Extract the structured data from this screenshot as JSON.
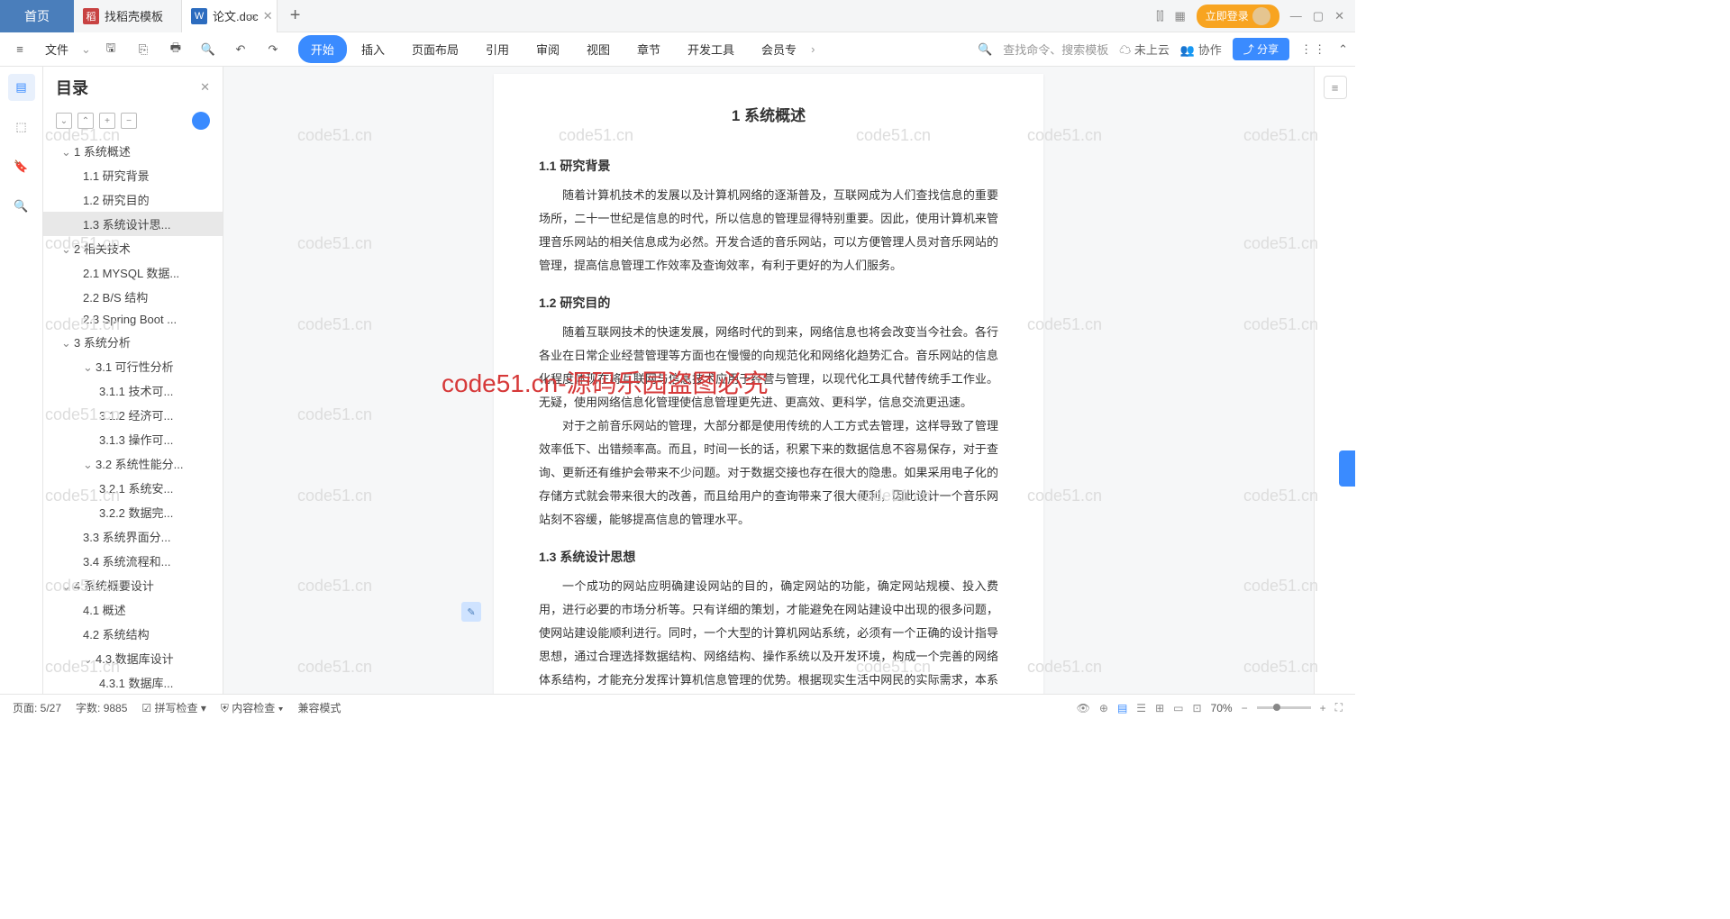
{
  "tabs": {
    "home": "首页",
    "t1": "找稻壳模板",
    "t2": "论文.doc",
    "login": "立即登录"
  },
  "menu": {
    "file": "文件",
    "items": [
      "开始",
      "插入",
      "页面布局",
      "引用",
      "审阅",
      "视图",
      "章节",
      "开发工具",
      "会员专"
    ],
    "search": "查找命令、搜索模板",
    "cloud": "未上云",
    "collab": "协作",
    "share": "分享"
  },
  "sidebar": {
    "title": "目录"
  },
  "toc": [
    {
      "l": 1,
      "c": true,
      "t": "1 系统概述"
    },
    {
      "l": 2,
      "t": "1.1 研究背景"
    },
    {
      "l": 2,
      "t": "1.2 研究目的"
    },
    {
      "l": 2,
      "t": "1.3 系统设计思...",
      "sel": true
    },
    {
      "l": 1,
      "c": true,
      "t": "2 相关技术"
    },
    {
      "l": 2,
      "t": "2.1 MYSQL 数据..."
    },
    {
      "l": 2,
      "t": "2.2 B/S 结构"
    },
    {
      "l": 2,
      "t": "2.3 Spring Boot ..."
    },
    {
      "l": 1,
      "c": true,
      "t": "3 系统分析"
    },
    {
      "l": 2,
      "c": true,
      "t": "3.1 可行性分析"
    },
    {
      "l": 3,
      "t": "3.1.1 技术可..."
    },
    {
      "l": 3,
      "t": "3.1.2 经济可..."
    },
    {
      "l": 3,
      "t": "3.1.3 操作可..."
    },
    {
      "l": 2,
      "c": true,
      "t": "3.2 系统性能分..."
    },
    {
      "l": 3,
      "t": "3.2.1 系统安..."
    },
    {
      "l": 3,
      "t": "3.2.2 数据完..."
    },
    {
      "l": 2,
      "t": "3.3 系统界面分..."
    },
    {
      "l": 2,
      "t": "3.4 系统流程和..."
    },
    {
      "l": 1,
      "c": true,
      "t": "4 系统概要设计"
    },
    {
      "l": 2,
      "t": "4.1 概述"
    },
    {
      "l": 2,
      "t": "4.2 系统结构"
    },
    {
      "l": 2,
      "c": true,
      "t": "4.3.数据库设计"
    },
    {
      "l": 3,
      "t": "4.3.1 数据库..."
    }
  ],
  "doc": {
    "h1": "1 系统概述",
    "s11": "1.1 研究背景",
    "p11": "随着计算机技术的发展以及计算机网络的逐渐普及，互联网成为人们查找信息的重要场所，二十一世纪是信息的时代，所以信息的管理显得特别重要。因此，使用计算机来管理音乐网站的相关信息成为必然。开发合适的音乐网站，可以方便管理人员对音乐网站的管理，提高信息管理工作效率及查询效率，有利于更好的为人们服务。",
    "s12": "1.2 研究目的",
    "p12a": "随着互联网技术的快速发展，网络时代的到来，网络信息也将会改变当今社会。各行各业在日常企业经营管理等方面也在慢慢的向规范化和网络化趋势汇合。音乐网站的信息化程度体现在将互联网与信息技术应用于经营与管理，以现代化工具代替传统手工作业。无疑，使用网络信息化管理使信息管理更先进、更高效、更科学，信息交流更迅速。",
    "p12b": "对于之前音乐网站的管理，大部分都是使用传统的人工方式去管理，这样导致了管理效率低下、出错频率高。而且，时间一长的话，积累下来的数据信息不容易保存，对于查询、更新还有维护会带来不少问题。对于数据交接也存在很大的隐患。如果采用电子化的存储方式就会带来很大的改善，而且给用户的查询带来了很大便利，因此设计一个音乐网站刻不容缓，能够提高信息的管理水平。",
    "s13": "1.3 系统设计思想",
    "p13": "一个成功的网站应明确建设网站的目的，确定网站的功能，确定网站规模、投入费用，进行必要的市场分析等。只有详细的策划，才能避免在网站建设中出现的很多问题，使网站建设能顺利进行。同时，一个大型的计算机网站系统，必须有一个正确的设计指导思想，通过合理选择数据结构、网络结构、操作系统以及开发环境，构成一个完善的网络体系结构，才能充分发挥计算机信息管理的优势。根据现实生活中网民的实际需求，本系统的设计按照下述原则进行。"
  },
  "status": {
    "page": "页面: 5/27",
    "words": "字数: 9885",
    "spell": "拼写检查",
    "content": "内容检查",
    "compat": "兼容模式",
    "zoom": "70%"
  },
  "watermark_red": "code51.cn-源码乐园盗图必究"
}
